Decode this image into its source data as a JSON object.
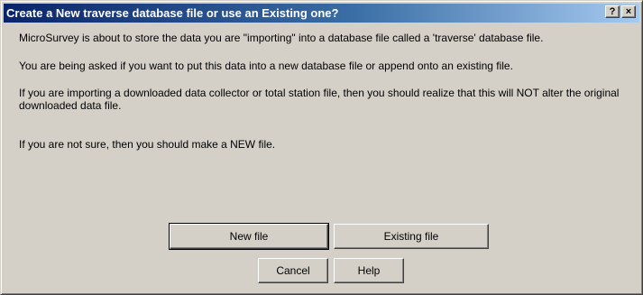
{
  "dialog": {
    "title": "Create a New traverse database file or use an Existing one?",
    "caption_buttons": {
      "help": "?",
      "close": "×"
    },
    "messages": [
      "MicroSurvey is about to store the data you are \"importing\" into a database file called a 'traverse' database file.",
      "You are being asked if you want to put this data into a new database file or append onto an existing file.",
      "If you are importing a downloaded data collector or total station file, then you should realize that this will NOT alter the original downloaded data file.",
      "If you are not sure, then you should make a NEW file."
    ],
    "buttons": {
      "new_file": "New file",
      "existing_file": "Existing file",
      "cancel": "Cancel",
      "help": "Help"
    }
  }
}
